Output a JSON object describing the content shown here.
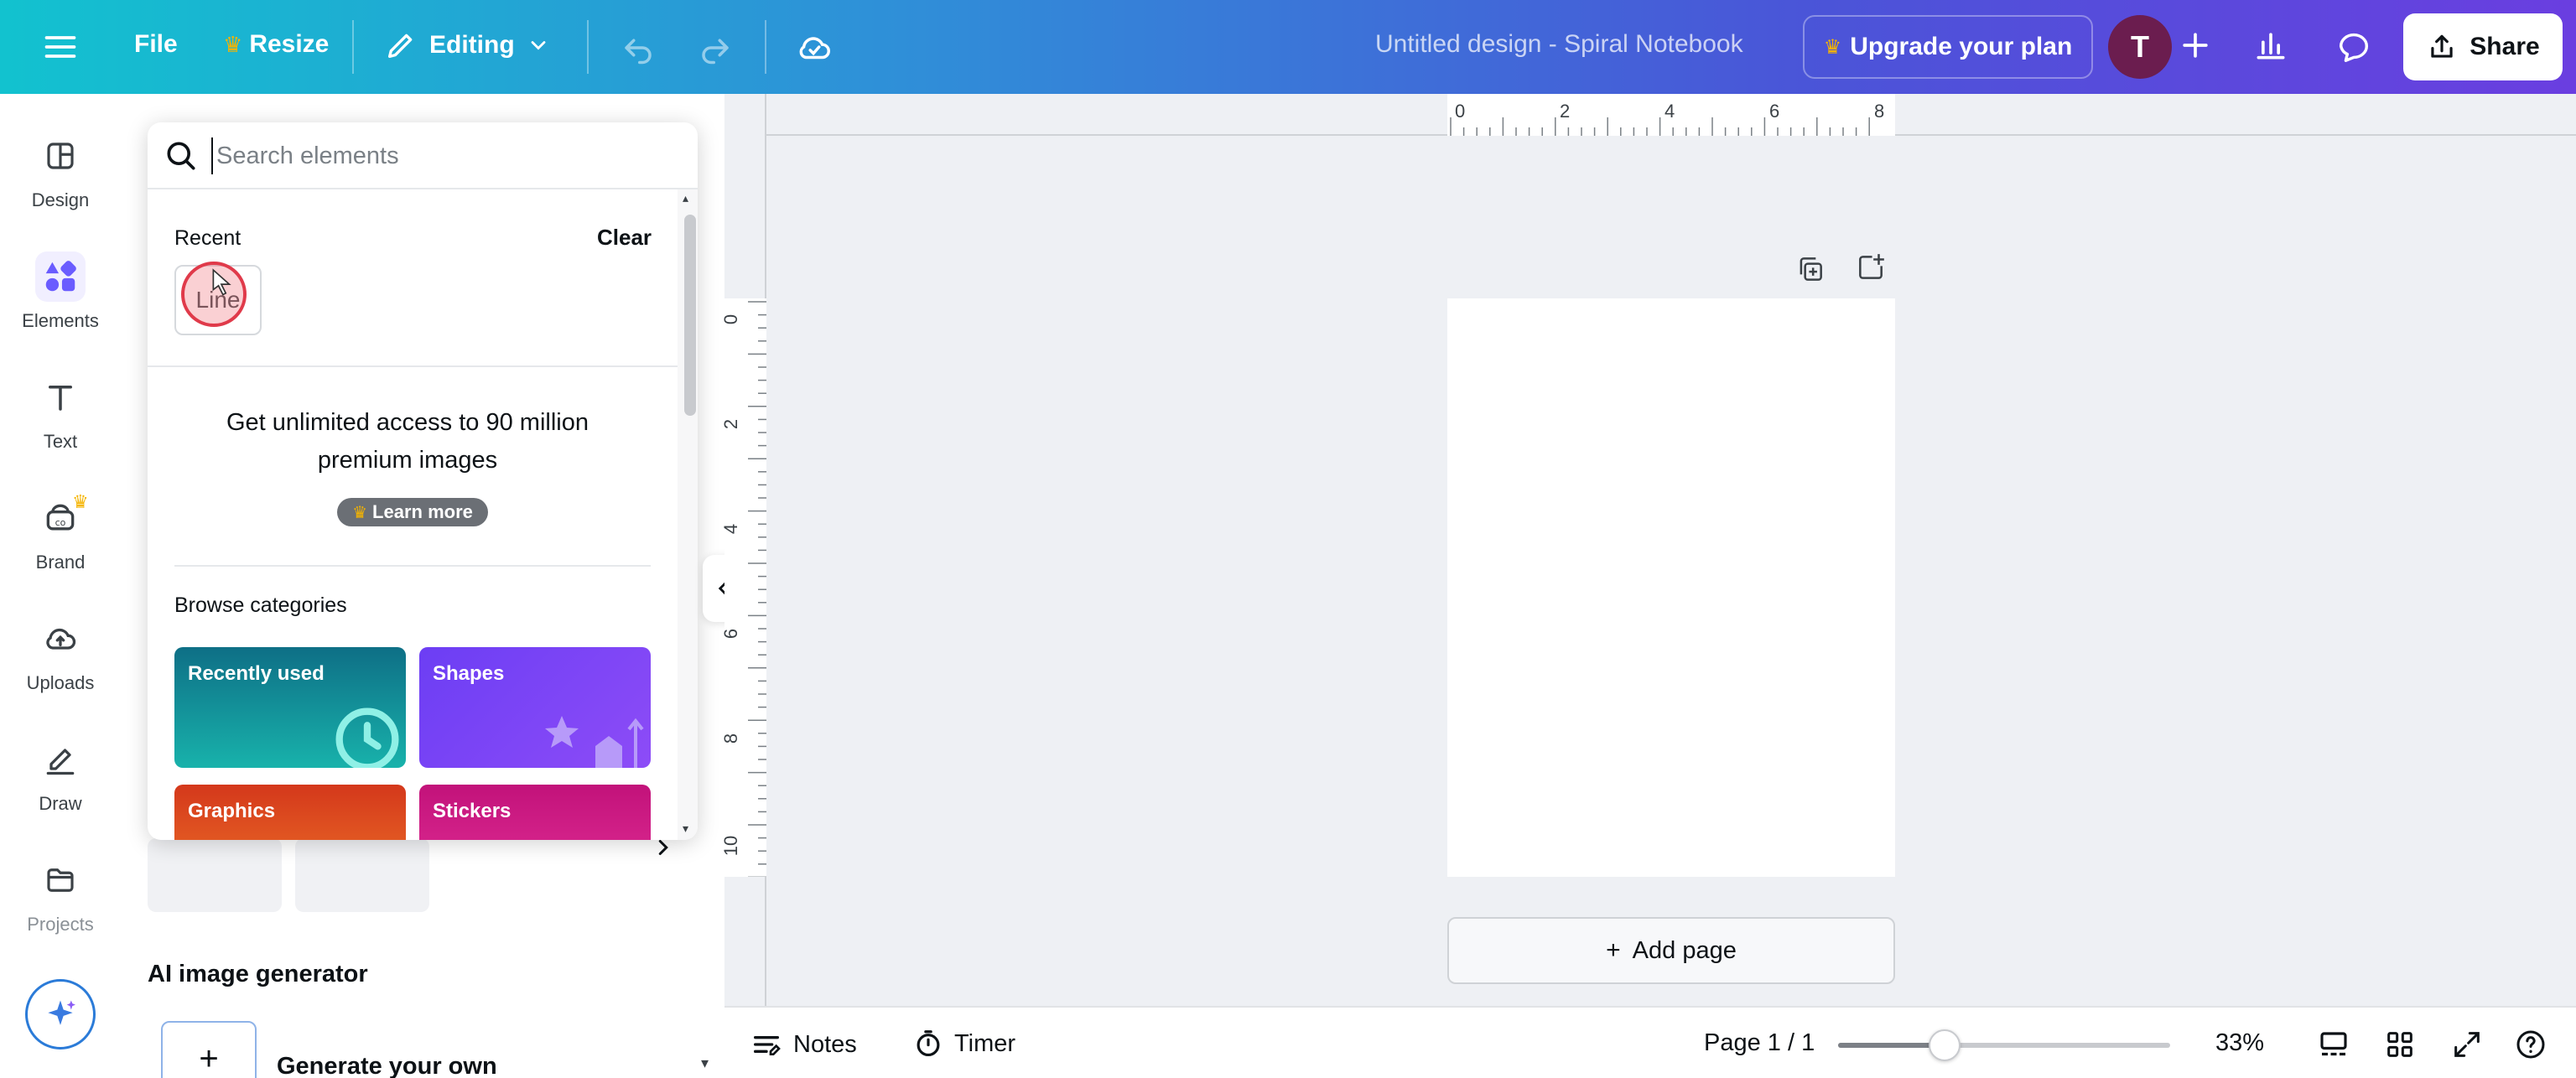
{
  "topbar": {
    "file_label": "File",
    "resize_label": "Resize",
    "editing_label": "Editing",
    "title": "Untitled design - Spiral Notebook",
    "upgrade_label": "Upgrade your plan",
    "avatar_initial": "T",
    "share_label": "Share",
    "crown_color": "#f5b400"
  },
  "rail": {
    "items": [
      {
        "label": "Design",
        "icon": "layout-icon"
      },
      {
        "label": "Elements",
        "icon": "shapes-icon"
      },
      {
        "label": "Text",
        "icon": "text-icon"
      },
      {
        "label": "Brand",
        "icon": "brand-icon"
      },
      {
        "label": "Uploads",
        "icon": "cloud-upload-icon"
      },
      {
        "label": "Draw",
        "icon": "pen-icon"
      },
      {
        "label": "Projects",
        "icon": "folder-icon"
      }
    ],
    "active": "Elements",
    "accent_color": "#6a5cff"
  },
  "elements_popup": {
    "search_placeholder": "Search elements",
    "search_value": "",
    "recent_label": "Recent",
    "clear_label": "Clear",
    "recent_items": [
      "Line"
    ],
    "promo_text": "Get unlimited access to 90 million premium images",
    "learn_more_label": "Learn more",
    "browse_label": "Browse categories",
    "categories": [
      {
        "label": "Recently used",
        "color": "#0f8a9a"
      },
      {
        "label": "Shapes",
        "color": "#7b3cf5"
      },
      {
        "label": "Graphics",
        "color": "#e0431c"
      },
      {
        "label": "Stickers",
        "color": "#d6127e"
      }
    ]
  },
  "panel": {
    "ai_section_title": "AI image generator",
    "generate_label": "Generate your own"
  },
  "canvas": {
    "ruler_top_labels": [
      "0",
      "2",
      "4",
      "6",
      "8"
    ],
    "ruler_left_labels": [
      "0",
      "2",
      "4",
      "6",
      "8",
      "10"
    ],
    "add_page_label": "Add page"
  },
  "bottombar": {
    "notes_label": "Notes",
    "timer_label": "Timer",
    "page_indicator": "Page 1 / 1",
    "zoom_label": "33%",
    "zoom_value_percent": 33
  }
}
